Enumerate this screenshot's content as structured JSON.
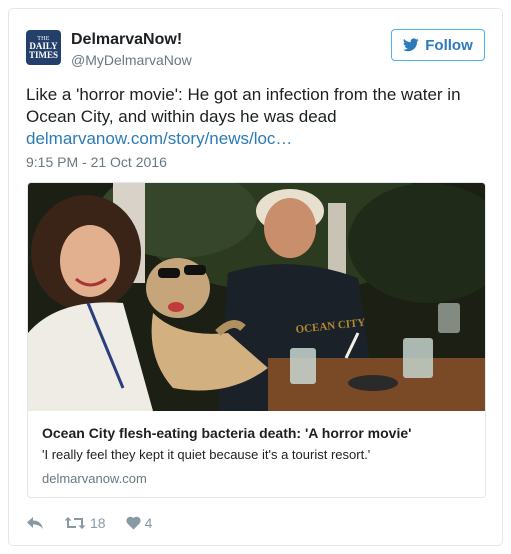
{
  "author": {
    "avatar_line1": "THE",
    "avatar_line2": "DAILY",
    "avatar_line3": "TIMES",
    "name": "DelmarvaNow!",
    "handle": "@MyDelmarvaNow"
  },
  "follow": {
    "label": "Follow",
    "icon": "twitter-bird-icon"
  },
  "tweet": {
    "text": "Like a 'horror movie': He got an infection from the water in Ocean City, and within days he was dead",
    "link": "delmarvanow.com/story/news/loc…",
    "timestamp": "9:15 PM - 21 Oct 2016"
  },
  "card": {
    "title": "Ocean City flesh-eating bacteria death: 'A horror movie'",
    "description": "'I really feel they kept it quiet because it's a tourist resort.'",
    "domain": "delmarvanow.com",
    "photo_shirt_text": "OCEAN CITY"
  },
  "actions": {
    "reply_icon": "reply-icon",
    "retweet_icon": "retweet-icon",
    "retweet_count": "18",
    "like_icon": "heart-icon",
    "like_count": "4"
  },
  "colors": {
    "accent": "#2b7bb9",
    "secondary_text": "#697882",
    "border": "#e1e8ed",
    "follow_border": "#4ab3f4"
  }
}
